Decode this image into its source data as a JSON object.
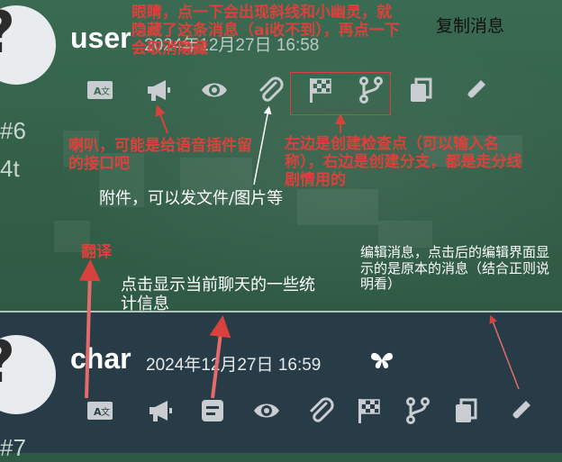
{
  "messages": [
    {
      "name": "user",
      "timestamp": "2024年12月27日 16:58",
      "number": "#6",
      "token_fragment": "4t"
    },
    {
      "name": "char",
      "timestamp": "2024年12月27日 16:59",
      "number": "#7"
    }
  ],
  "annotations": {
    "eye": "眼睛，点一下会出现斜线和小幽灵，就隐藏了这条消息（ai收不到），再点一下会取消隐藏",
    "copy": "复制消息",
    "horn": "喇叭，可能是给语音插件留的接口吧",
    "attach": "附件，可以发文件/图片等",
    "branch": "左边是创建检查点（可以输入名称），右边是创建分支，都是走分线剧情用的",
    "translate": "翻译",
    "stats": "点击显示当前聊天的一些统计信息",
    "edit": "编辑消息，点击后的编辑界面显示的是原本的消息（结合正则说明看）"
  },
  "icons": {
    "top_toolbar": [
      "translate-icon",
      "megaphone-icon",
      "eye-icon",
      "paperclip-icon",
      "flag-icon",
      "branch-icon",
      "copy-icon",
      "pencil-icon"
    ],
    "bottom_toolbar": [
      "translate-icon",
      "megaphone-icon",
      "stats-icon",
      "eye-icon",
      "paperclip-icon",
      "flag-icon",
      "branch-icon",
      "copy-icon",
      "pencil-icon"
    ],
    "header_extra": "butterfly-icon"
  },
  "colors": {
    "annotation_red": "#d9423c",
    "top_bg": "#3a6b52",
    "bottom_bg": "#283c47",
    "icon": "#c9cdd1"
  }
}
